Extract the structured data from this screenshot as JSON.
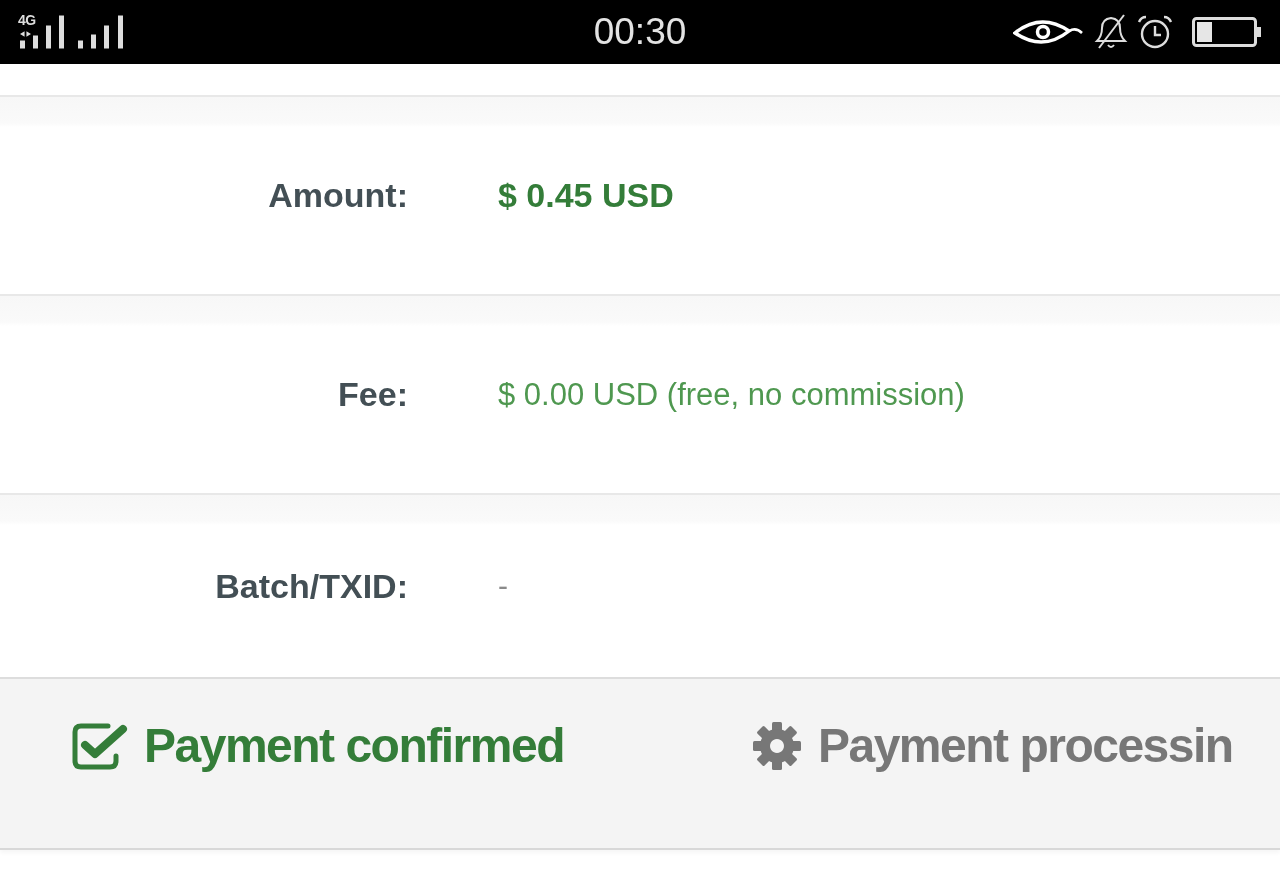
{
  "status_bar": {
    "network_type": "4G",
    "time": "00:30"
  },
  "details": [
    {
      "label": "Amount:",
      "value": "$ 0.45 USD",
      "kind": "highlight"
    },
    {
      "label": "Fee:",
      "value": "$ 0.00 USD (free, no commission)",
      "kind": "note"
    },
    {
      "label": "Batch/TXID:",
      "value": "-",
      "kind": "plain"
    }
  ],
  "progress_steps": [
    {
      "label": "Payment confirmed",
      "done": true
    },
    {
      "label": "Payment processin",
      "done": false
    }
  ]
}
